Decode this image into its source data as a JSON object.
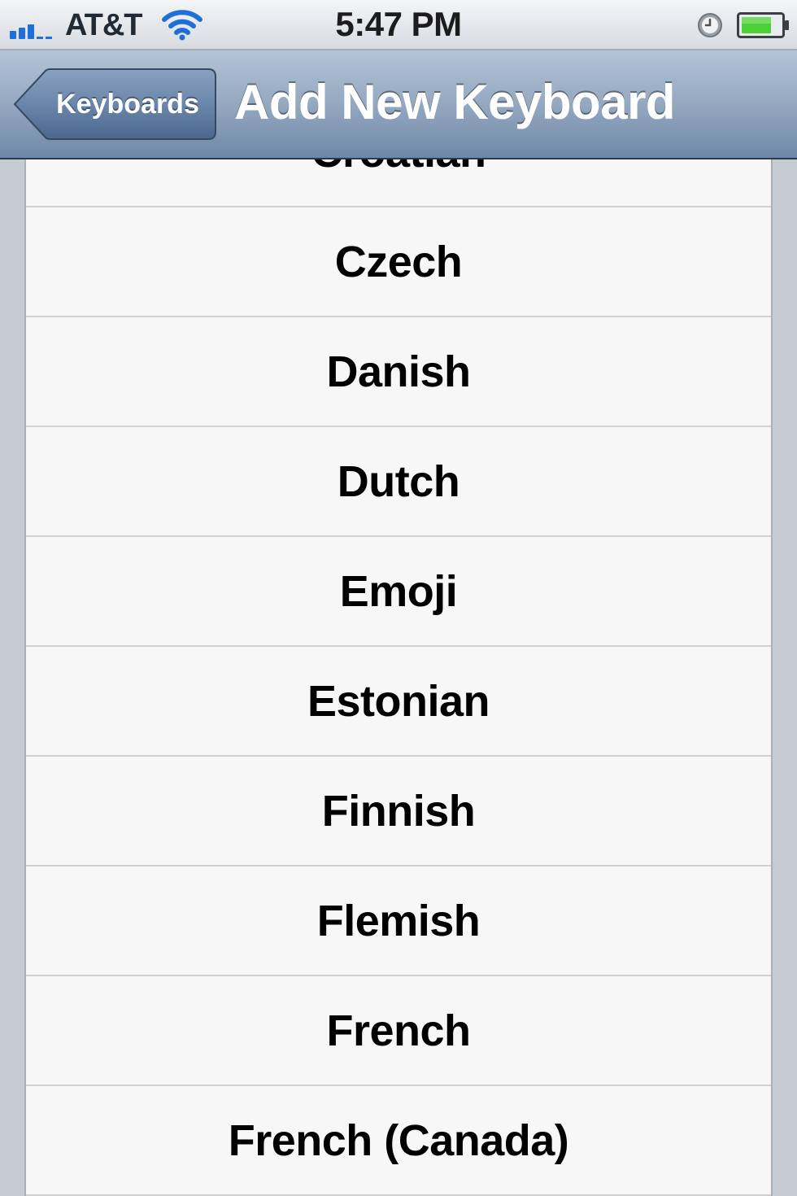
{
  "status_bar": {
    "carrier": "AT&T",
    "time": "5:47 PM",
    "signal_icon": "signal-bars-icon",
    "wifi_icon": "wifi-icon",
    "alarm_icon": "alarm-clock-icon",
    "battery_icon": "battery-icon",
    "battery_color": "#4cd137",
    "signal_color": "#1f6fd6"
  },
  "nav_bar": {
    "back_label": "Keyboards",
    "title": "Add New Keyboard",
    "tint_color": "#6f88a7"
  },
  "keyboards": [
    {
      "label": "Croatian"
    },
    {
      "label": "Czech"
    },
    {
      "label": "Danish"
    },
    {
      "label": "Dutch"
    },
    {
      "label": "Emoji"
    },
    {
      "label": "Estonian"
    },
    {
      "label": "Finnish"
    },
    {
      "label": "Flemish"
    },
    {
      "label": "French"
    },
    {
      "label": "French (Canada)"
    }
  ]
}
